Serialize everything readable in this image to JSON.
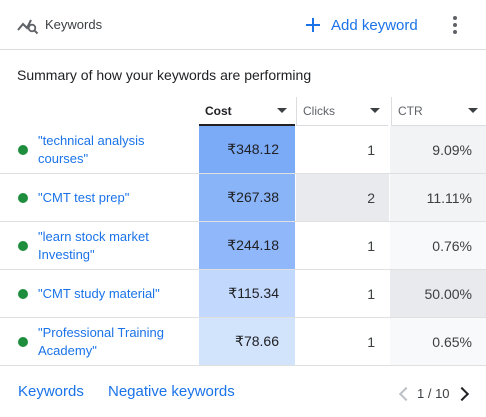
{
  "header": {
    "title": "Keywords",
    "add_label": "Add keyword",
    "icon": "keywords-search-icon"
  },
  "summary": "Summary of how your keywords are performing",
  "columns": [
    {
      "label": "Cost",
      "sorted": true
    },
    {
      "label": "Clicks",
      "sorted": false
    },
    {
      "label": "CTR",
      "sorted": false
    }
  ],
  "rows": [
    {
      "keyword": "\"technical analysis courses\"",
      "cost": "₹348.12",
      "clicks": "1",
      "ctr": "9.09%",
      "cost_color": "#7baaf7",
      "clicks_color": "#ffffff",
      "ctr_color": "#f1f3f4"
    },
    {
      "keyword": "\"CMT test prep\"",
      "cost": "₹267.38",
      "clicks": "2",
      "ctr": "11.11%",
      "cost_color": "#8ab4f8",
      "clicks_color": "#e8eaed",
      "ctr_color": "#f1f3f4"
    },
    {
      "keyword": "\"learn stock market Investing\"",
      "cost": "₹244.18",
      "clicks": "1",
      "ctr": "0.76%",
      "cost_color": "#8fb7f9",
      "clicks_color": "#ffffff",
      "ctr_color": "#f8f9fa"
    },
    {
      "keyword": "\"CMT study material\"",
      "cost": "₹115.34",
      "clicks": "1",
      "ctr": "50.00%",
      "cost_color": "#c2d8fc",
      "clicks_color": "#ffffff",
      "ctr_color": "#e8eaed"
    },
    {
      "keyword": "\"Professional Training Academy\"",
      "cost": "₹78.66",
      "clicks": "1",
      "ctr": "0.65%",
      "cost_color": "#d2e3fc",
      "clicks_color": "#ffffff",
      "ctr_color": "#f8f9fa"
    }
  ],
  "footer": {
    "keywords_link": "Keywords",
    "negative_link": "Negative keywords",
    "page_text": "1 / 10"
  },
  "colors": {
    "accent": "#1a73e8",
    "status_dot": "#1e8e3e"
  }
}
